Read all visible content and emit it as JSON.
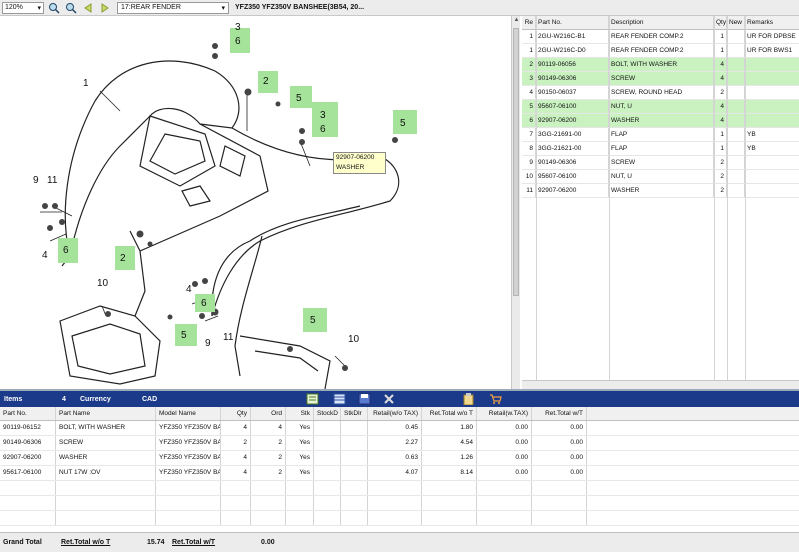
{
  "toolbar": {
    "zoom": "120%",
    "page_select": "17:REAR FENDER",
    "model_title": "YFZ350 YFZ350V BANSHEE(3B54, 20..."
  },
  "diagram": {
    "callouts": [
      "3",
      "6",
      "2",
      "5",
      "3",
      "6",
      "5",
      "6",
      "2",
      "6",
      "5",
      "5"
    ],
    "labels": [
      "1",
      "9",
      "11",
      "4",
      "10",
      "4",
      "9",
      "11",
      "10"
    ],
    "tooltip": {
      "part_no": "92907-06200",
      "name": "WASHER"
    }
  },
  "parts_table": {
    "headers": [
      "Re",
      "Part No.",
      "Description",
      "Qty",
      "New",
      "Remarks"
    ],
    "rows": [
      {
        "ref": "1",
        "part_no": "2GU-W216C-B1",
        "desc": "REAR FENDER COMP.2",
        "qty": "1",
        "new": "",
        "remarks": "UR FOR DPBSE"
      },
      {
        "ref": "1",
        "part_no": "2GU-W216C-D0",
        "desc": "REAR FENDER COMP.2",
        "qty": "1",
        "new": "",
        "remarks": "UR FOR BWS1"
      },
      {
        "ref": "2",
        "part_no": "90119-06056",
        "desc": "BOLT, WITH WASHER",
        "qty": "4",
        "new": "",
        "remarks": ""
      },
      {
        "ref": "3",
        "part_no": "90149-06306",
        "desc": "SCREW",
        "qty": "4",
        "new": "",
        "remarks": ""
      },
      {
        "ref": "4",
        "part_no": "90150-06037",
        "desc": "SCREW, ROUND HEAD",
        "qty": "2",
        "new": "",
        "remarks": ""
      },
      {
        "ref": "5",
        "part_no": "95607-06100",
        "desc": "NUT, U",
        "qty": "4",
        "new": "",
        "remarks": ""
      },
      {
        "ref": "6",
        "part_no": "92907-06200",
        "desc": "WASHER",
        "qty": "4",
        "new": "",
        "remarks": ""
      },
      {
        "ref": "7",
        "part_no": "3GG-21691-00",
        "desc": "FLAP",
        "qty": "1",
        "new": "",
        "remarks": "YB"
      },
      {
        "ref": "8",
        "part_no": "3GG-21621-00",
        "desc": "FLAP",
        "qty": "1",
        "new": "",
        "remarks": "YB"
      },
      {
        "ref": "9",
        "part_no": "90149-06306",
        "desc": "SCREW",
        "qty": "2",
        "new": "",
        "remarks": ""
      },
      {
        "ref": "10",
        "part_no": "95607-06100",
        "desc": "NUT, U",
        "qty": "2",
        "new": "",
        "remarks": ""
      },
      {
        "ref": "11",
        "part_no": "92907-06200",
        "desc": "WASHER",
        "qty": "2",
        "new": "",
        "remarks": ""
      }
    ]
  },
  "cart": {
    "items_label": "Items",
    "items_count": "4",
    "currency_label": "Currency",
    "currency": "CAD",
    "headers": [
      "Part No.",
      "Part Name",
      "Model Name",
      "Qty",
      "Ord",
      "Stk",
      "StockD",
      "StkDlr",
      "Retail(w/o TAX)",
      "Ret.Total w/o T",
      "Retail(w.TAX)",
      "Ret.Total w/T"
    ],
    "rows": [
      {
        "part_no": "90119-06152",
        "name": "BOLT, WITH WASHER",
        "model": "YFZ350 YFZ350V BA",
        "qty": "4",
        "ord": "4",
        "stk": "Yes",
        "stockd": "",
        "stkdlr": "",
        "retail": "0.45",
        "ret_total": "1.80",
        "retail_tax": "0.00",
        "ret_total_tax": "0.00"
      },
      {
        "part_no": "90149-06306",
        "name": "SCREW",
        "model": "YFZ350 YFZ350V BA",
        "qty": "2",
        "ord": "2",
        "stk": "Yes",
        "stockd": "",
        "stkdlr": "",
        "retail": "2.27",
        "ret_total": "4.54",
        "retail_tax": "0.00",
        "ret_total_tax": "0.00"
      },
      {
        "part_no": "92907-06200",
        "name": "WASHER",
        "model": "YFZ350 YFZ350V BA",
        "qty": "4",
        "ord": "2",
        "stk": "Yes",
        "stockd": "",
        "stkdlr": "",
        "retail": "0.63",
        "ret_total": "1.26",
        "retail_tax": "0.00",
        "ret_total_tax": "0.00"
      },
      {
        "part_no": "95617-06100",
        "name": "NUT 17W :OV",
        "model": "YFZ350 YFZ350V BA",
        "qty": "4",
        "ord": "2",
        "stk": "Yes",
        "stockd": "",
        "stkdlr": "",
        "retail": "4.07",
        "ret_total": "8.14",
        "retail_tax": "0.00",
        "ret_total_tax": "0.00"
      }
    ]
  },
  "footer": {
    "grand_total_label": "Grand Total",
    "ret_total_wo_label": "Ret.Total w/o T",
    "ret_total_wo_value": "15.74",
    "ret_total_w_label": "Ret.Total w/T",
    "ret_total_w_value": "0.00"
  },
  "colors": {
    "highlight_row": "#c9f2c0",
    "callout_green": "#a6e39a",
    "cart_bar": "#1c3a8a"
  },
  "icons": [
    "chevron-down-icon",
    "zoom-in-icon",
    "zoom-out-icon",
    "back-arrow-icon",
    "forward-arrow-icon",
    "cart-list-icon",
    "cart-table-icon",
    "save-icon",
    "tools-icon",
    "clipboard-icon",
    "cart-icon"
  ]
}
